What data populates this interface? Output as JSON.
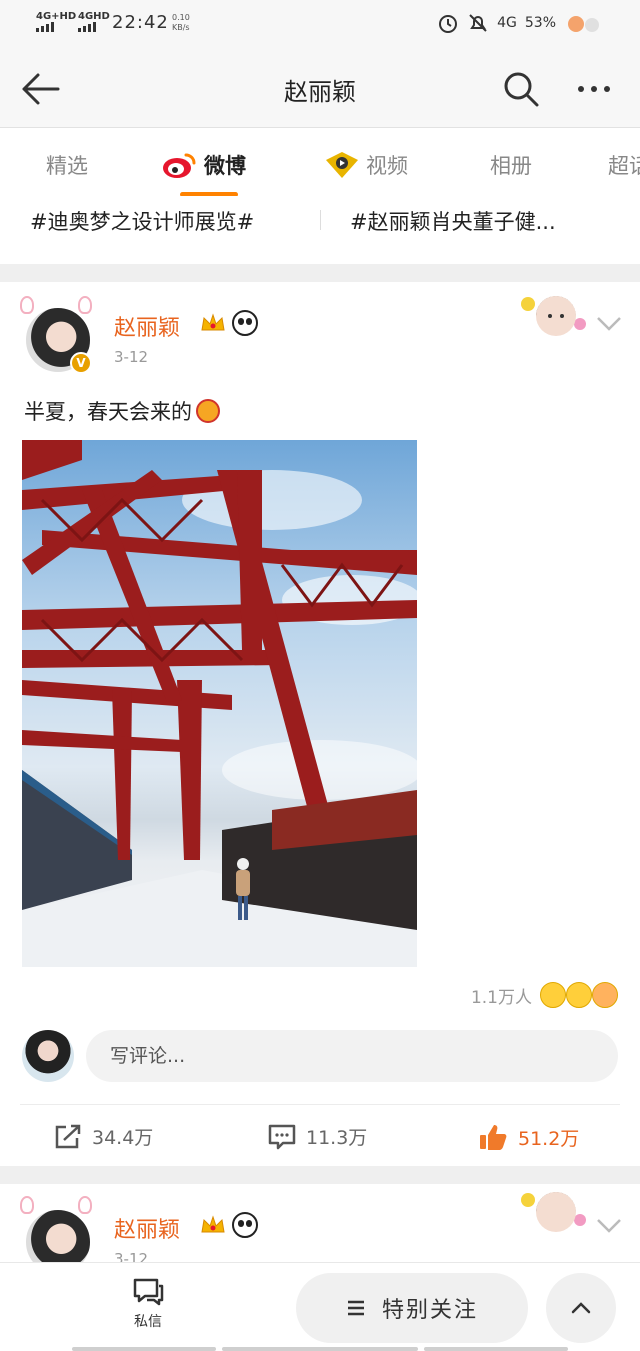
{
  "status_bar": {
    "net1": "4G+HD",
    "net2": "4GHD",
    "time": "22:42",
    "speed_value": "0.10",
    "speed_unit": "KB/s",
    "net3": "4G",
    "battery": "53%"
  },
  "header": {
    "title": "赵丽颖",
    "back_icon": "arrow-left-icon",
    "search_icon": "search-icon",
    "more_icon": "more-dots-icon"
  },
  "tabs": [
    "精选",
    "微博",
    "视频",
    "相册",
    "超话"
  ],
  "topics": [
    "#迪奥梦之设计师展览#",
    "#赵丽颖肖央董子健..."
  ],
  "post": {
    "author": "赵丽颖",
    "verified_mark": "V",
    "date": "3-12",
    "text": "半夏，春天会来的",
    "reaction_count": "1.1万人",
    "comment_placeholder": "写评论...",
    "reposts": "34.4万",
    "comments": "11.3万",
    "likes": "51.2万"
  },
  "post2": {
    "author": "赵丽颖",
    "date": "3-12"
  },
  "bottom_bar": {
    "message_label": "私信",
    "follow_label": "特别关注"
  },
  "colors": {
    "accent": "#ff8200",
    "name": "#e8641f",
    "liked": "#e8641f"
  }
}
